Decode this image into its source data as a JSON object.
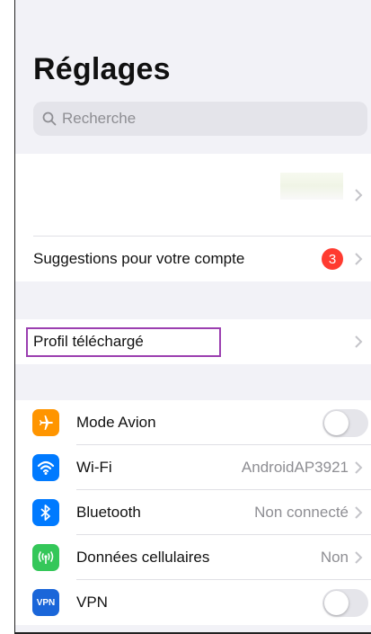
{
  "page_title": "Réglages",
  "search": {
    "placeholder": "Recherche"
  },
  "account_group": {
    "suggestions_label": "Suggestions pour votre compte",
    "suggestions_badge": "3"
  },
  "profile_group": {
    "label": "Profil téléchargé"
  },
  "connectivity": {
    "airplane": {
      "label": "Mode Avion",
      "icon": "airplane-icon",
      "color": "#ff9500",
      "on": false
    },
    "wifi": {
      "label": "Wi-Fi",
      "value": "AndroidAP3921",
      "icon": "wifi-icon",
      "color": "#007aff"
    },
    "bluetooth": {
      "label": "Bluetooth",
      "value": "Non connecté",
      "icon": "bluetooth-icon",
      "color": "#007aff"
    },
    "cellular": {
      "label": "Données cellulaires",
      "value": "Non",
      "icon": "antenna-icon",
      "color": "#34c759"
    },
    "vpn": {
      "label": "VPN",
      "icon_text": "VPN",
      "icon": "vpn-icon",
      "color": "#1a66d9",
      "on": false
    }
  },
  "colors": {
    "highlight": "#9b3fb0",
    "badge": "#ff3b30"
  }
}
